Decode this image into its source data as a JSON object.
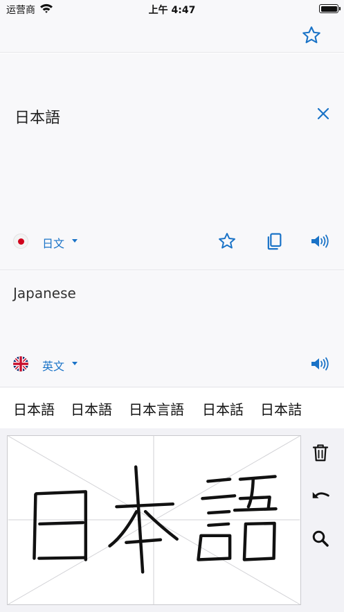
{
  "status_bar": {
    "carrier": "运营商",
    "time": "上午 4:47",
    "icons": [
      "wifi-icon",
      "battery-icon"
    ]
  },
  "header": {
    "favorites_icon": "star-outline-icon"
  },
  "source": {
    "text": "日本語",
    "clear_icon": "close-icon",
    "language": {
      "flag": "japan-flag",
      "label": "日文"
    },
    "actions": [
      "star-outline-icon",
      "copy-icon",
      "speaker-icon"
    ]
  },
  "target": {
    "text": "Japanese",
    "language": {
      "flag": "uk-flag",
      "label": "英文"
    },
    "actions": [
      "speaker-icon"
    ]
  },
  "candidates": [
    "日本語",
    "日本語",
    "日本言語",
    "日本話",
    "日本詰"
  ],
  "handwriting": {
    "tools": [
      "trash-icon",
      "undo-icon",
      "search-icon"
    ]
  },
  "colors": {
    "accent": "#1a73c7",
    "panel_bg": "#f8f8fa",
    "pad_bg": "#f2f2f6"
  }
}
